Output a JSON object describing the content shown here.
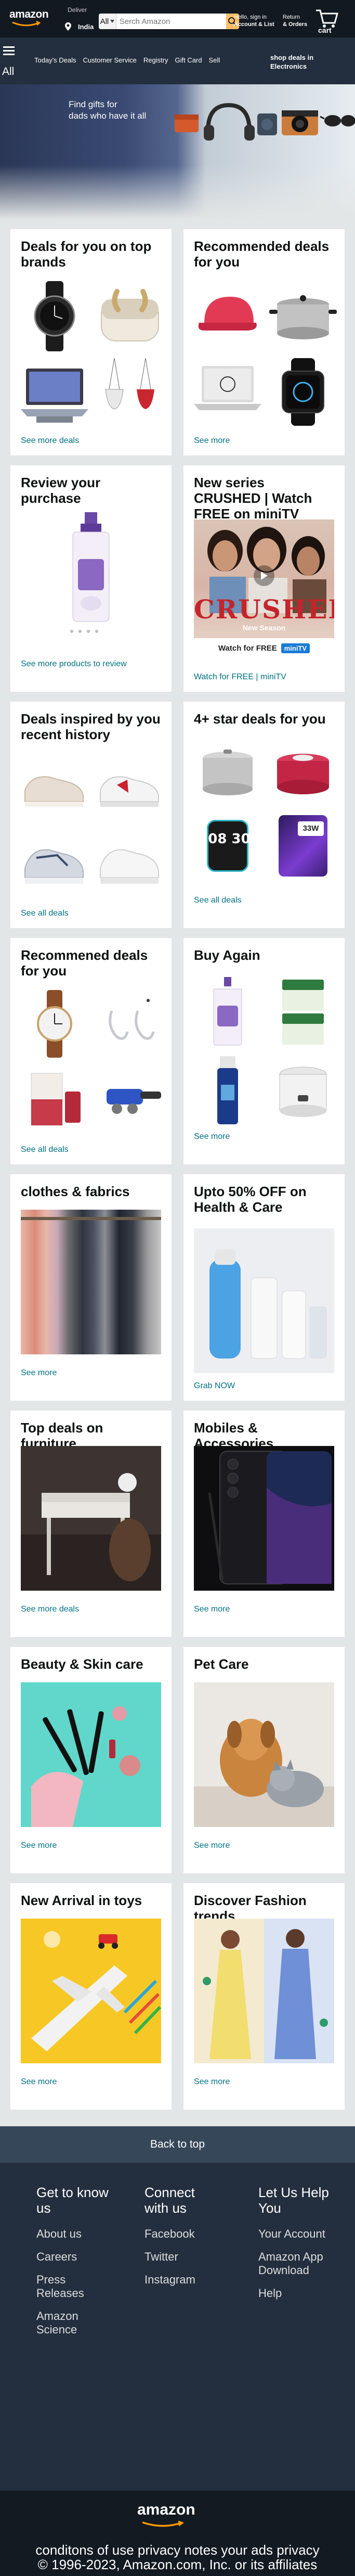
{
  "header": {
    "logo": "amazon",
    "deliver_label": "Deliver",
    "location": "India",
    "search_category": "All",
    "search_placeholder": "Serch Amazon",
    "signin_line1": "Hello, sign in",
    "signin_line2": "Account & List",
    "returns_line1": "Return",
    "returns_line2": "& Orders",
    "cart_label": "cart"
  },
  "nav": {
    "menu_label": "All",
    "links": [
      "Today's Deals",
      "Customer Service",
      "Registry",
      "Gift Card",
      "Sell"
    ],
    "promo_line1": "shop deals in",
    "promo_line2": "Electronics"
  },
  "hero": {
    "line1": "Find gifts for",
    "line2": "dads who have it all"
  },
  "cards": [
    {
      "title": "Deals for you on top brands",
      "link": "See more deals"
    },
    {
      "title": "Recommended deals for you",
      "link": "See more"
    },
    {
      "title": "Review your purchase",
      "link": "See more products to review"
    },
    {
      "title": "New series CRUSHED | Watch FREE on miniTV",
      "link": "Watch for FREE | miniTV",
      "poster_title": "CRUSHED",
      "poster_sub": "New Season",
      "poster_cta": "Watch for FREE",
      "poster_brand": "miniTV"
    },
    {
      "title": "Deals inspired by you recent history",
      "link": "See all deals"
    },
    {
      "title": "4+ star deals for you",
      "link": "See all deals",
      "clock_text": "08 30",
      "phone_text": "33W"
    },
    {
      "title": "Recommened deals for you",
      "link": "See all deals"
    },
    {
      "title": "Buy Again",
      "link": "See more"
    },
    {
      "title": "clothes & fabrics",
      "link": "See more"
    },
    {
      "title": "Upto 50% OFF on Health & Care",
      "link": "Grab NOW"
    },
    {
      "title": "Top deals on furniture",
      "link": "See more deals"
    },
    {
      "title": "Mobiles & Accessories",
      "link": "See more"
    },
    {
      "title": "Beauty & Skin care",
      "link": "See more"
    },
    {
      "title": "Pet Care",
      "link": "See more"
    },
    {
      "title": "New Arrival in toys",
      "link": "See more"
    },
    {
      "title": "Discover Fashion trends",
      "link": "See more"
    }
  ],
  "footer": {
    "back_to_top": "Back to top",
    "columns": [
      {
        "title": "Get to know us",
        "links": [
          "About us",
          "Careers",
          "Press Releases",
          "Amazon Science"
        ]
      },
      {
        "title": "Connect with us",
        "links": [
          "Facebook",
          "Twitter",
          "Instagram"
        ]
      },
      {
        "title": "Let Us Help You",
        "links": [
          "Your Account",
          "Amazon App Download",
          "Help"
        ]
      }
    ],
    "logo": "amazon",
    "bottom_line1": "conditons of use privacy notes your ads privacy",
    "bottom_line2": "© 1996-2023, Amazon.com, Inc. or its affiliates"
  },
  "colors": {
    "header_bg": "#131921",
    "nav_bg": "#232f3e",
    "back_top_bg": "#37475a",
    "footer_bg": "#232f3e",
    "footer_bottom_bg": "#131a22",
    "search_button": "#febd69",
    "link": "#007185"
  }
}
